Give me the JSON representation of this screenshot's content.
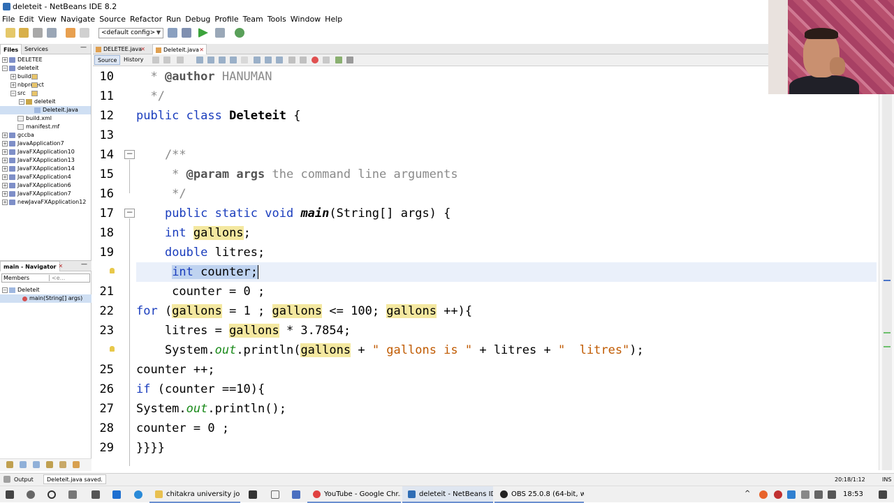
{
  "window": {
    "title": "deleteit - NetBeans IDE 8.2"
  },
  "menu": [
    "File",
    "Edit",
    "View",
    "Navigate",
    "Source",
    "Refactor",
    "Run",
    "Debug",
    "Profile",
    "Team",
    "Tools",
    "Window",
    "Help"
  ],
  "toolbar": {
    "config": "<default config>"
  },
  "left_panel": {
    "tabs": [
      "Files",
      "Services"
    ],
    "minimize": "—",
    "tree": [
      {
        "label": "DELETEE",
        "type": "proj",
        "depth": 0,
        "toggle": "+"
      },
      {
        "label": "deleteit",
        "type": "proj",
        "depth": 0,
        "toggle": "−"
      },
      {
        "label": "build",
        "type": "fold",
        "depth": 1,
        "toggle": "+"
      },
      {
        "label": "nbproject",
        "type": "fold",
        "depth": 1,
        "toggle": "+"
      },
      {
        "label": "src",
        "type": "fold",
        "depth": 1,
        "toggle": "−"
      },
      {
        "label": "deleteit",
        "type": "pkg",
        "depth": 2,
        "toggle": "−"
      },
      {
        "label": "Deleteit.java",
        "type": "java",
        "depth": 3,
        "toggle": "",
        "selected": true
      },
      {
        "label": "build.xml",
        "type": "file",
        "depth": 1,
        "toggle": ""
      },
      {
        "label": "manifest.mf",
        "type": "file",
        "depth": 1,
        "toggle": ""
      },
      {
        "label": "gccba",
        "type": "proj",
        "depth": 0,
        "toggle": "+"
      },
      {
        "label": "JavaApplication7",
        "type": "proj",
        "depth": 0,
        "toggle": "+"
      },
      {
        "label": "JavaFXApplication10",
        "type": "proj",
        "depth": 0,
        "toggle": "+"
      },
      {
        "label": "JavaFXApplication13",
        "type": "proj",
        "depth": 0,
        "toggle": "+"
      },
      {
        "label": "JavaFXApplication14",
        "type": "proj",
        "depth": 0,
        "toggle": "+"
      },
      {
        "label": "JavaFXApplication4",
        "type": "proj",
        "depth": 0,
        "toggle": "+"
      },
      {
        "label": "JavaFXApplication6",
        "type": "proj",
        "depth": 0,
        "toggle": "+"
      },
      {
        "label": "JavaFXApplication7",
        "type": "proj",
        "depth": 0,
        "toggle": "+"
      },
      {
        "label": "newJavaFXApplication12",
        "type": "proj",
        "depth": 0,
        "toggle": "+"
      }
    ]
  },
  "navigator": {
    "title": "main - Navigator",
    "close": "✕",
    "minimize": "—",
    "filter": "Members",
    "filter2": "<e...",
    "class_name": "Deleteit",
    "method": "main(String[] args)"
  },
  "editor": {
    "tabs": [
      {
        "label": "DELETEE.java",
        "active": false
      },
      {
        "label": "Deleteit.java",
        "active": true
      }
    ],
    "modes": [
      "Source",
      "History"
    ],
    "line_numbers": [
      "10",
      "11",
      "12",
      "13",
      "14",
      "15",
      "16",
      "17",
      "18",
      "19",
      "",
      "21",
      "22",
      "23",
      "",
      "25",
      "26",
      "27",
      "28",
      "29"
    ]
  },
  "status": {
    "output_label": "Output",
    "message": "Deleteit.java saved.",
    "position": "20:18/1:12",
    "mode": "INS"
  },
  "taskbar": {
    "items": [
      "chitakra university jou...",
      "YouTube - Google Chr...",
      "deleteit - NetBeans ID...",
      "OBS 25.0.8 (64-bit, wi..."
    ],
    "time": "18:53"
  }
}
